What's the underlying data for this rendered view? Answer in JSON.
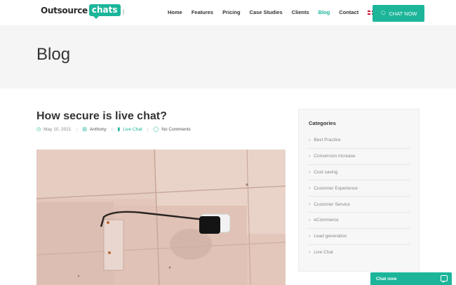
{
  "brand": {
    "logo_main": "Outsource",
    "logo_bubble": "chats",
    "logo_tld": ".com",
    "accent": "#1cb59a"
  },
  "nav": {
    "items": [
      "Home",
      "Features",
      "Pricing",
      "Case Studies",
      "Clients",
      "Blog",
      "Contact"
    ],
    "active": "Blog",
    "language_icon": "uk-flag-icon",
    "cta_label": "CHAT NOW"
  },
  "page": {
    "title": "Blog"
  },
  "post": {
    "title": "How secure is live chat?",
    "date": "May 10, 2021",
    "author": "Anthony",
    "category": "Live Chat",
    "comments": "No Comments",
    "image": "wall-mounted-security-camera"
  },
  "sidebar": {
    "title": "Categories",
    "items": [
      "Best Practice",
      "Conversion increase",
      "Cost saving",
      "Customer Experience",
      "Customer Service",
      "eCommerce",
      "Lead generation",
      "Live Chat"
    ]
  },
  "chat_widget": {
    "label": "Chat now"
  }
}
